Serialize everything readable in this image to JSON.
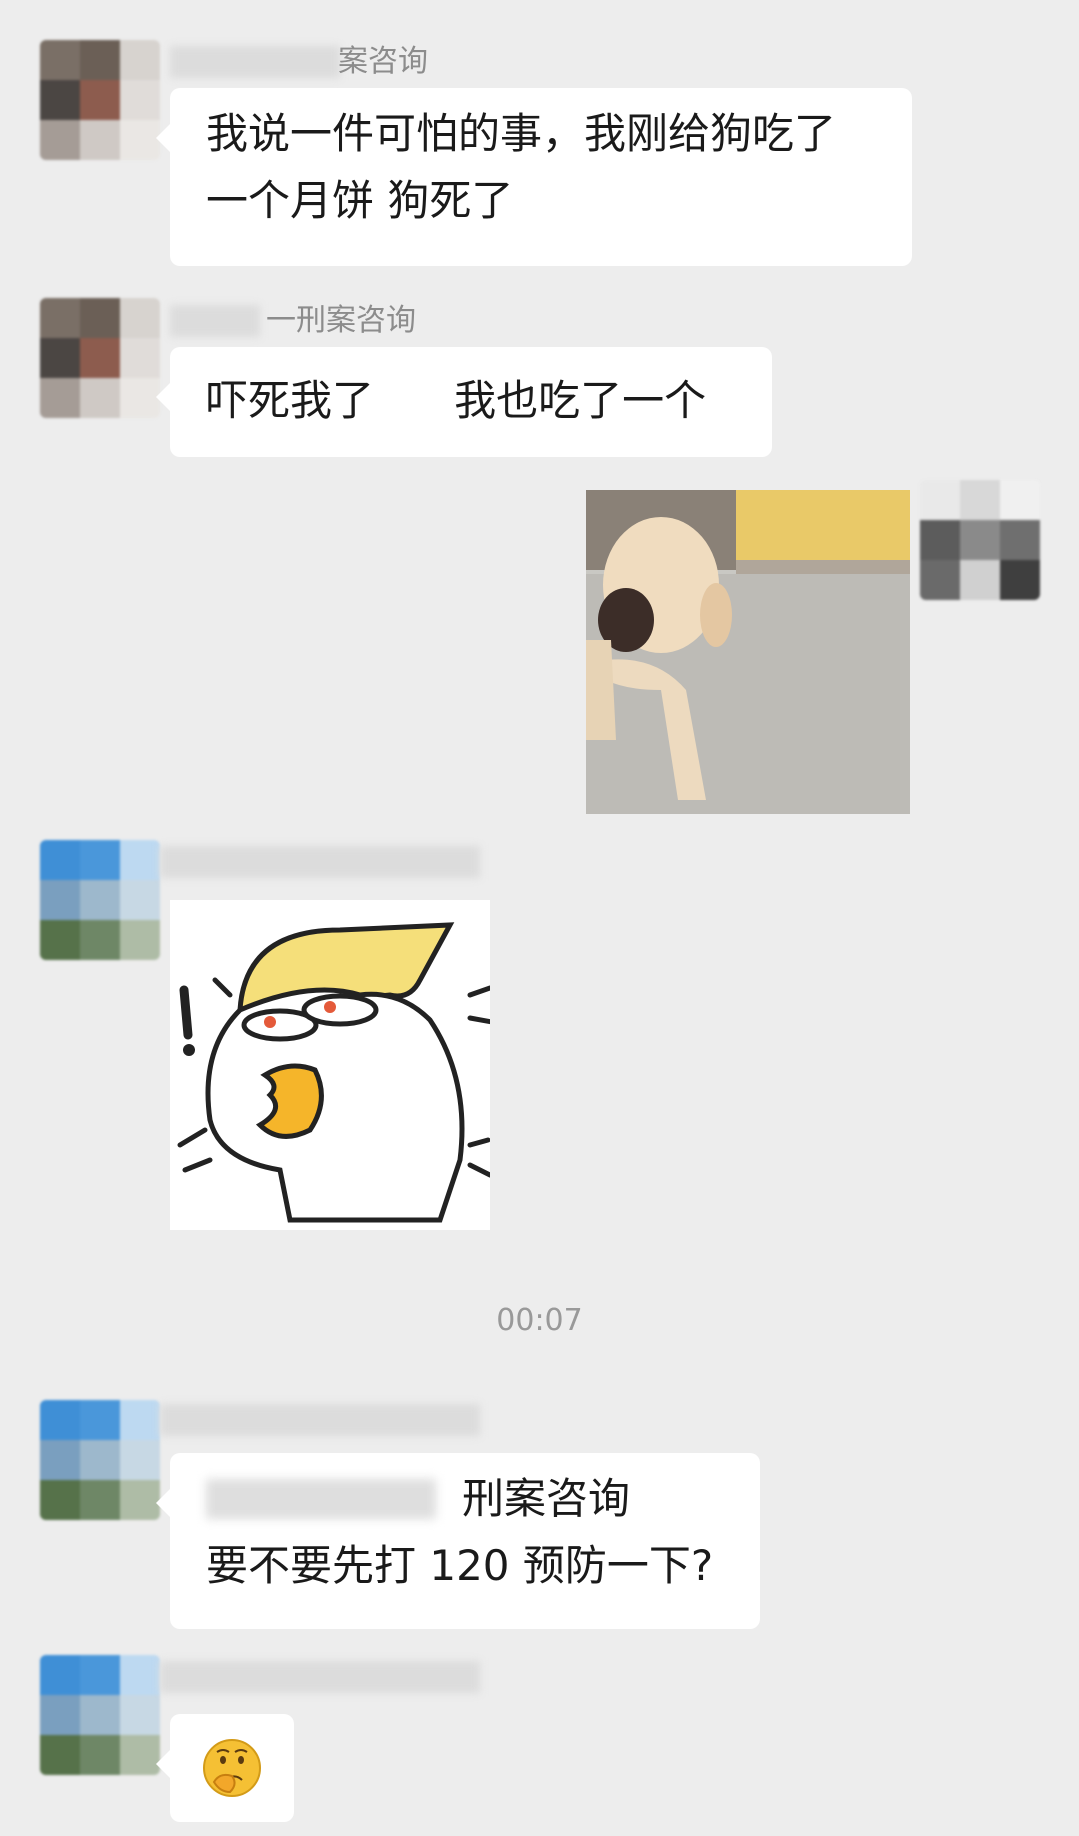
{
  "messages": [
    {
      "sender": "案咨询",
      "text_line1": "我说一件可怕的事，我刚给狗吃了",
      "text_line2": "一个月饼  狗死了"
    },
    {
      "sender": "一刑案咨询",
      "text": "吓死我了      我也吃了一个"
    },
    {
      "type": "image",
      "description_icon": "puppy-photo"
    },
    {
      "type": "sticker",
      "description_icon": "cartoon-eating-mooncake-sticker"
    },
    {
      "sender": "刑案咨询",
      "text": "要不要先打 120 预防一下?"
    },
    {
      "type": "emoji",
      "description_icon": "thinking-face-emoji"
    }
  ],
  "timestamp": "00:07",
  "colors": {
    "background": "#ededed",
    "bubble": "#ffffff",
    "name": "#8c8c8c",
    "timestamp": "#999999"
  }
}
